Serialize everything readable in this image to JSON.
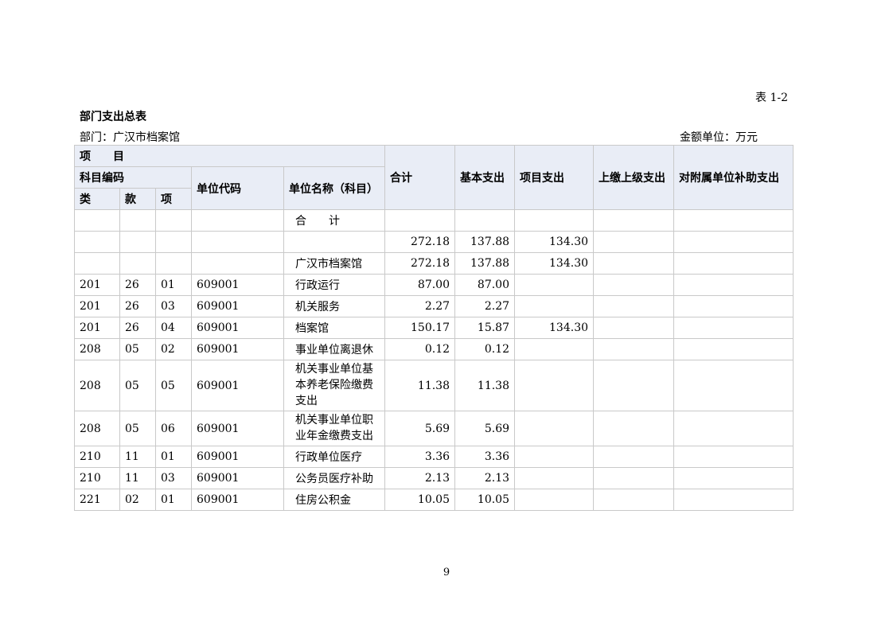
{
  "header": {
    "table_no": "表 1-2",
    "title": "部门支出总表",
    "department": "部门：广汉市档案馆",
    "unit": "金额单位：万元"
  },
  "columns": {
    "item": "项　　目",
    "subject_code": "科目编码",
    "category": "类",
    "section": "款",
    "entry": "项",
    "unit_code": "单位代码",
    "unit_name": "单位名称（科目）",
    "total": "合计",
    "basic": "基本支出",
    "project": "项目支出",
    "upper": "上缴上级支出",
    "subsidy": "对附属单位补助支出"
  },
  "total_label": "合　　计",
  "rows": [
    {
      "cat": "",
      "sec": "",
      "ent": "",
      "code": "",
      "name": "",
      "total": "272.18",
      "basic": "137.88",
      "project": "134.30",
      "upper": "",
      "subsidy": ""
    },
    {
      "cat": "",
      "sec": "",
      "ent": "",
      "code": "",
      "name": "广汉市档案馆",
      "total": "272.18",
      "basic": "137.88",
      "project": "134.30",
      "upper": "",
      "subsidy": ""
    },
    {
      "cat": "201",
      "sec": "26",
      "ent": "01",
      "code": "609001",
      "name": "行政运行",
      "total": "87.00",
      "basic": "87.00",
      "project": "",
      "upper": "",
      "subsidy": ""
    },
    {
      "cat": "201",
      "sec": "26",
      "ent": "03",
      "code": "609001",
      "name": "机关服务",
      "total": "2.27",
      "basic": "2.27",
      "project": "",
      "upper": "",
      "subsidy": ""
    },
    {
      "cat": "201",
      "sec": "26",
      "ent": "04",
      "code": "609001",
      "name": "档案馆",
      "total": "150.17",
      "basic": "15.87",
      "project": "134.30",
      "upper": "",
      "subsidy": ""
    },
    {
      "cat": "208",
      "sec": "05",
      "ent": "02",
      "code": "609001",
      "name": "事业单位离退休",
      "total": "0.12",
      "basic": "0.12",
      "project": "",
      "upper": "",
      "subsidy": ""
    },
    {
      "cat": "208",
      "sec": "05",
      "ent": "05",
      "code": "609001",
      "name": "机关事业单位基本养老保险缴费支出",
      "total": "11.38",
      "basic": "11.38",
      "project": "",
      "upper": "",
      "subsidy": ""
    },
    {
      "cat": "208",
      "sec": "05",
      "ent": "06",
      "code": "609001",
      "name": "机关事业单位职业年金缴费支出",
      "total": "5.69",
      "basic": "5.69",
      "project": "",
      "upper": "",
      "subsidy": ""
    },
    {
      "cat": "210",
      "sec": "11",
      "ent": "01",
      "code": "609001",
      "name": "行政单位医疗",
      "total": "3.36",
      "basic": "3.36",
      "project": "",
      "upper": "",
      "subsidy": ""
    },
    {
      "cat": "210",
      "sec": "11",
      "ent": "03",
      "code": "609001",
      "name": "公务员医疗补助",
      "total": "2.13",
      "basic": "2.13",
      "project": "",
      "upper": "",
      "subsidy": ""
    },
    {
      "cat": "221",
      "sec": "02",
      "ent": "01",
      "code": "609001",
      "name": "住房公积金",
      "total": "10.05",
      "basic": "10.05",
      "project": "",
      "upper": "",
      "subsidy": ""
    }
  ],
  "footer": {
    "page_number": "9"
  }
}
